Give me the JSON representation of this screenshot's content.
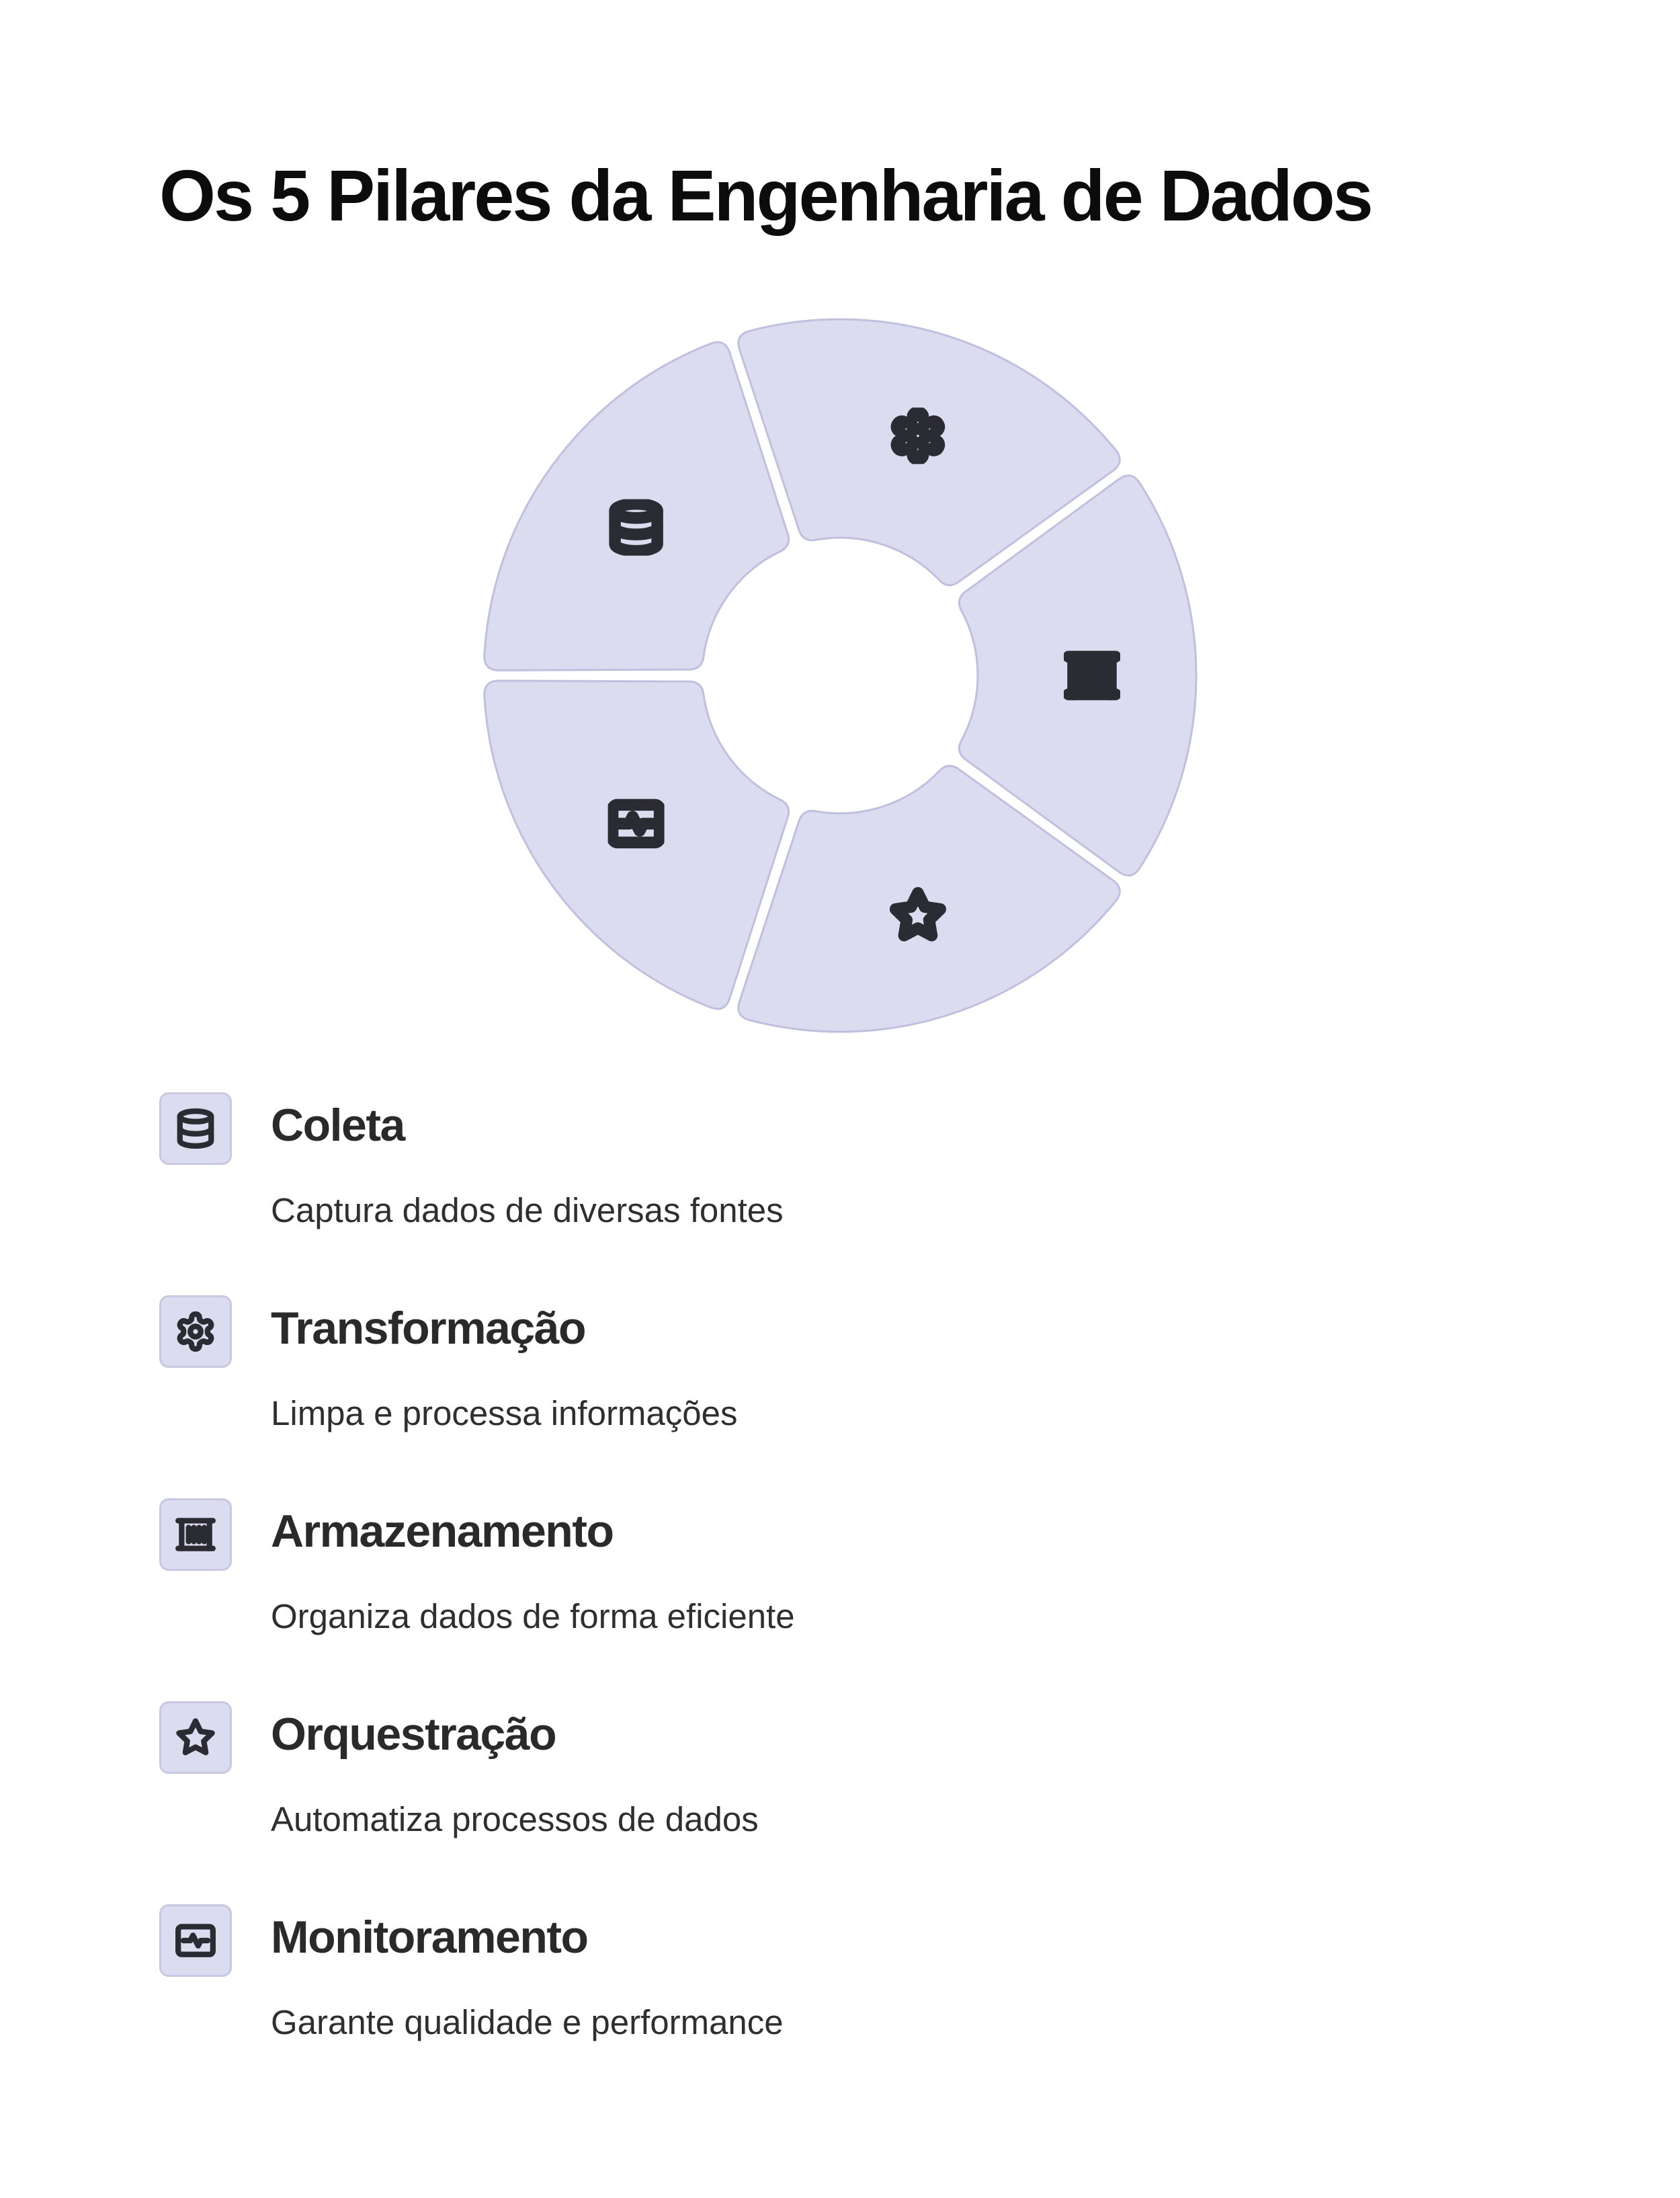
{
  "title": "Os 5 Pilares da Engenharia de Dados",
  "colors": {
    "segment_fill": "#dcdcf0",
    "segment_stroke": "#c0c0de",
    "icon_stroke": "#2b2b33",
    "title_text": "#0c0c0c",
    "body_text": "#2b2b2b"
  },
  "pillars": [
    {
      "icon": "database-icon",
      "title": "Coleta",
      "description": "Captura dados de diversas fontes"
    },
    {
      "icon": "gear-icon",
      "title": "Transformação",
      "description": "Limpa e processa informações"
    },
    {
      "icon": "container-icon",
      "title": "Armazenamento",
      "description": "Organiza dados de forma eficiente"
    },
    {
      "icon": "star-icon",
      "title": "Orquestração",
      "description": "Automatiza processos de dados"
    },
    {
      "icon": "monitor-pulse-icon",
      "title": "Monitoramento",
      "description": "Garante qualidade e performance"
    }
  ]
}
